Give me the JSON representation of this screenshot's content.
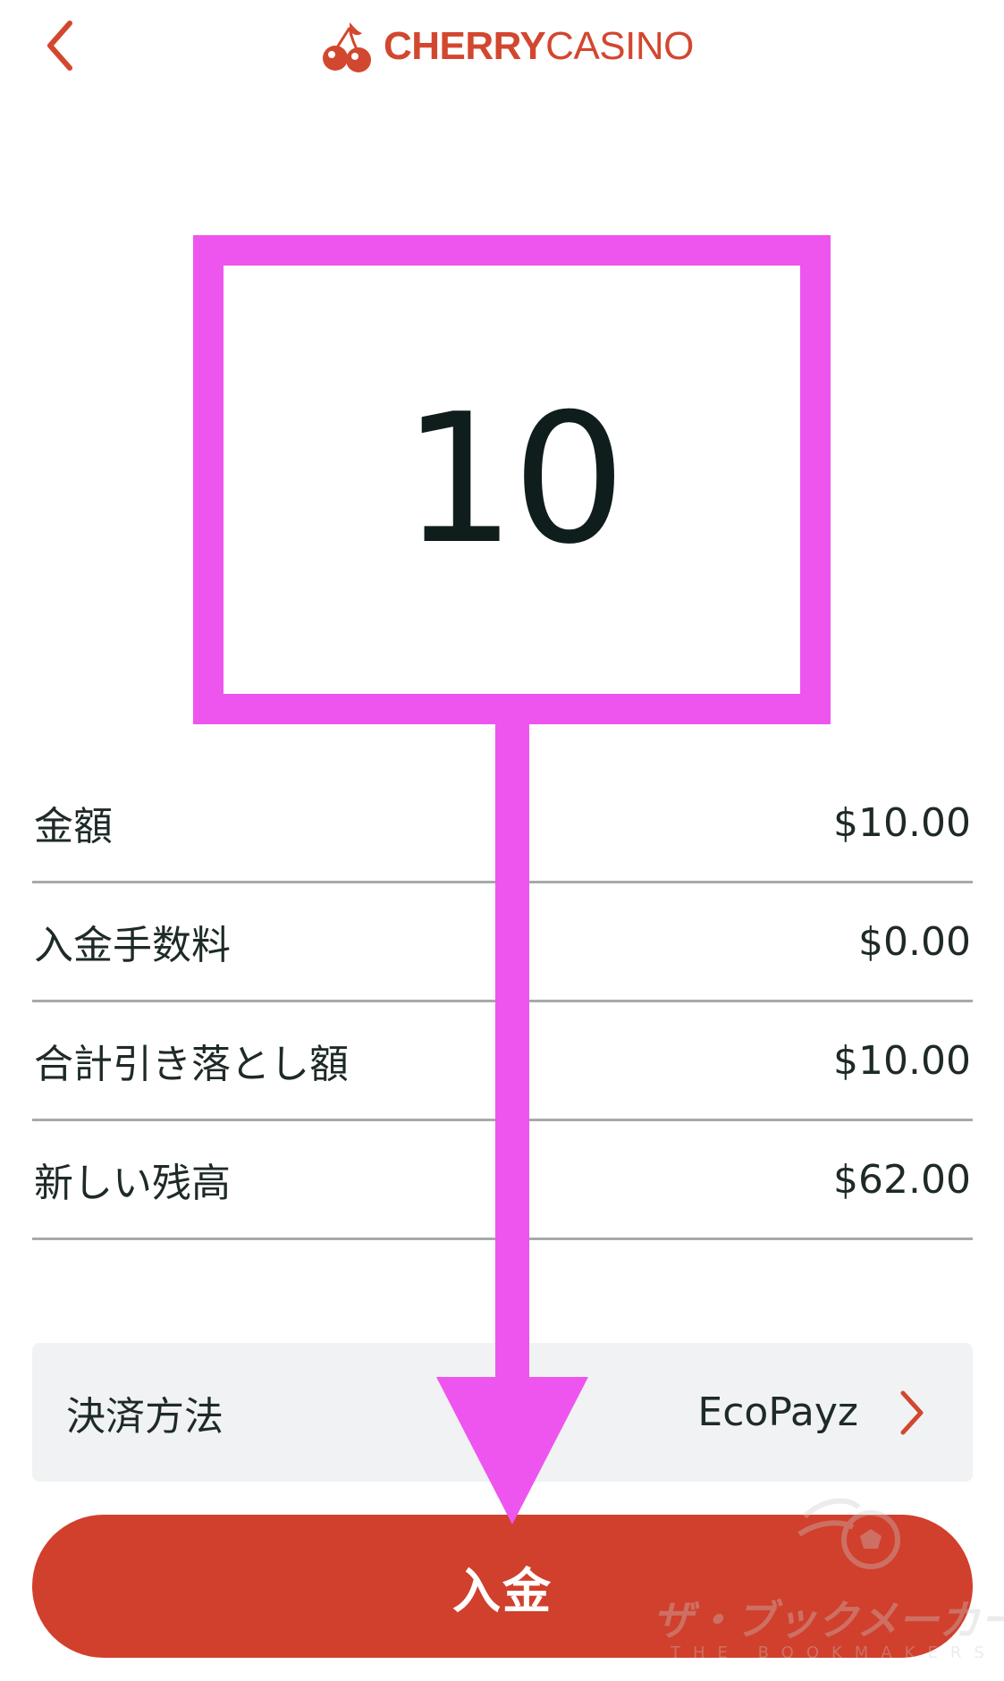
{
  "header": {
    "back_icon": "chevron-left-icon",
    "logo": {
      "brand_bold": "CHERRY",
      "brand_light": "CASINO",
      "icon": "cherry-icon"
    }
  },
  "amount_input": {
    "value": "10"
  },
  "summary": {
    "rows": [
      {
        "label": "金額",
        "value": "$10.00"
      },
      {
        "label": "入金手数料",
        "value": "$0.00"
      },
      {
        "label": "合計引き落とし額",
        "value": "$10.00"
      },
      {
        "label": "新しい残高",
        "value": "$62.00"
      }
    ]
  },
  "payment_method": {
    "label": "決済方法",
    "value": "EcoPayz",
    "icon": "chevron-right-icon"
  },
  "deposit_button": {
    "label": "入金"
  },
  "watermark": {
    "title": "ザ・ブックメーカーズ",
    "subtitle": "THE BOOKMAKERS"
  },
  "colors": {
    "brand": "#d2472f",
    "button": "#d0402c",
    "annotation": "#ee55ee",
    "text": "#1e2a28",
    "panel": "#f1f2f3",
    "divider": "#a8aaa9"
  }
}
